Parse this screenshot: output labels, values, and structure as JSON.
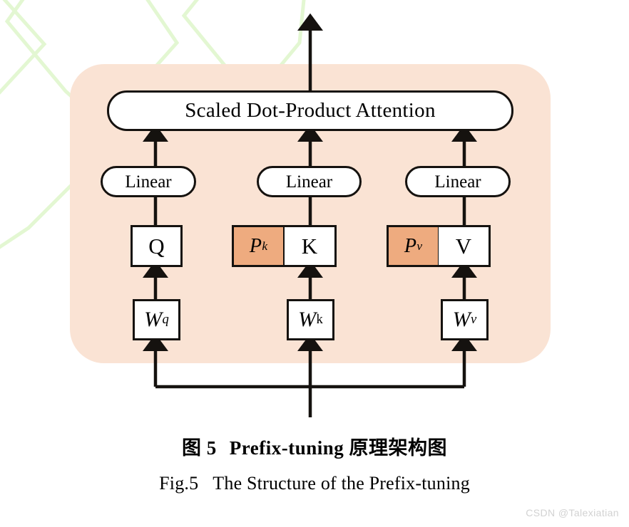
{
  "figure": {
    "panel_color": "#fae3d4",
    "prefix_color": "#eeab7f",
    "line_color": "#15120f",
    "attention_block": {
      "label": "Scaled Dot-Product Attention"
    },
    "projection_layers": [
      {
        "id": "q",
        "label": "Linear"
      },
      {
        "id": "k",
        "label": "Linear"
      },
      {
        "id": "v",
        "label": "Linear"
      }
    ],
    "qkv_nodes": [
      {
        "id": "q",
        "label": "Q",
        "prefix": null
      },
      {
        "id": "k",
        "label": "K",
        "prefix": "P",
        "prefix_subscript": "k"
      },
      {
        "id": "v",
        "label": "V",
        "prefix": "P",
        "prefix_subscript": "v"
      }
    ],
    "weight_nodes": [
      {
        "id": "wq",
        "base": "W",
        "subscript": "q",
        "subscript_style": "italic"
      },
      {
        "id": "wk",
        "base": "W",
        "subscript": "k",
        "subscript_style": "roman"
      },
      {
        "id": "wv",
        "base": "W",
        "subscript": "v",
        "subscript_style": "italic"
      }
    ]
  },
  "caption": {
    "cn_figure_label": "图 5",
    "cn_title_bold": "Prefix-tuning",
    "cn_title_rest": "原理架构图",
    "en_figure_label": "Fig.5",
    "en_title": "The Structure of the Prefix-tuning"
  },
  "watermark": {
    "text": "CSDN @Talexiatian"
  }
}
